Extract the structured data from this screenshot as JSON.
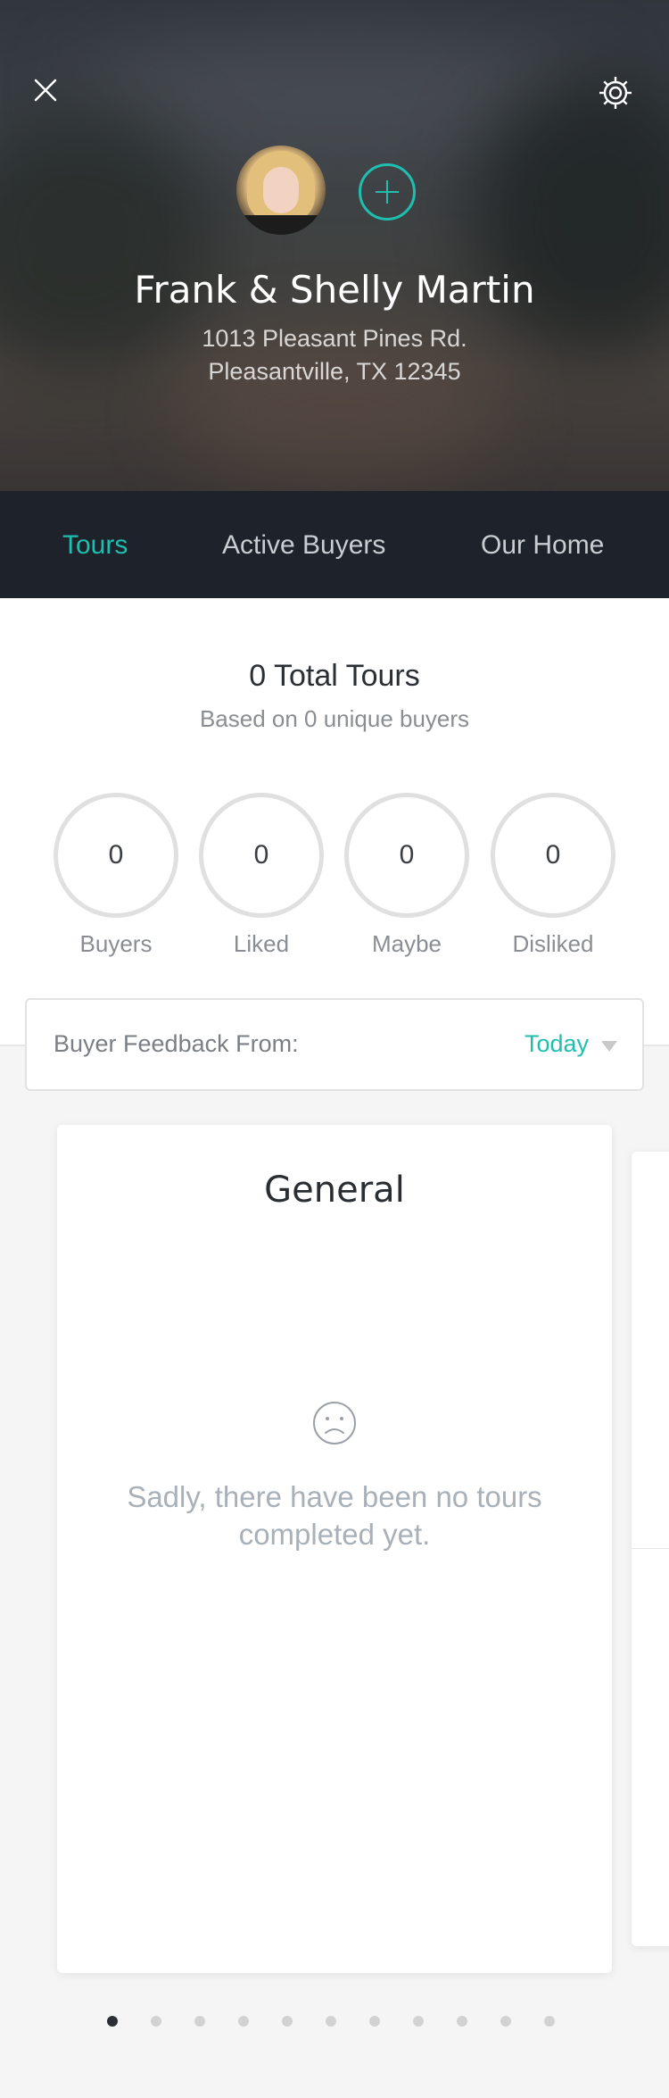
{
  "header": {
    "close_icon": "close-icon",
    "settings_icon": "gear-icon",
    "owner_name": "Frank & Shelly Martin",
    "address_line1": "1013 Pleasant Pines Rd.",
    "address_line2": "Pleasantville, TX 12345",
    "accent_color": "#1ebfae"
  },
  "nav": {
    "tabs": [
      {
        "label": "Tours",
        "active": true
      },
      {
        "label": "Active Buyers",
        "active": false
      },
      {
        "label": "Our Home",
        "active": false
      }
    ]
  },
  "summary": {
    "title": "0 Total Tours",
    "subtitle": "Based on 0 unique buyers",
    "stats": [
      {
        "value": "0",
        "label": "Buyers"
      },
      {
        "value": "0",
        "label": "Liked"
      },
      {
        "value": "0",
        "label": "Maybe"
      },
      {
        "value": "0",
        "label": "Disliked"
      }
    ]
  },
  "filter": {
    "label": "Buyer Feedback From:",
    "value": "Today"
  },
  "card": {
    "title": "General",
    "icon": "sad-face-icon",
    "empty_message": "Sadly, there have been no tours completed yet."
  },
  "pagination": {
    "total": 11,
    "current": 1
  }
}
